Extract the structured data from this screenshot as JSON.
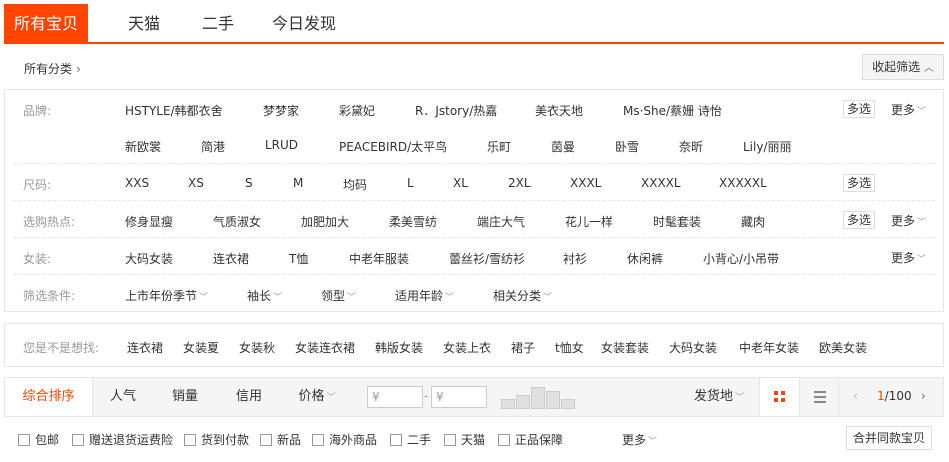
{
  "tabs": [
    "所有宝贝",
    "天猫",
    "二手",
    "今日发现"
  ],
  "breadcrumb": "所有分类",
  "collapse_label": "收起筛选",
  "filters": {
    "brand": {
      "label": "品牌:",
      "row1": [
        "HSTYLE/韩都衣舍",
        "梦梦家",
        "彩黛妃",
        "R．Jstory/热嘉",
        "美衣天地",
        "Ms·She/蔡姗 诗怡"
      ],
      "row2": [
        "新欧裳",
        "简港",
        "LRUD",
        "PEACEBIRD/太平鸟",
        "乐町",
        "茵曼",
        "卧雪",
        "奈昕",
        "Lily/丽丽"
      ]
    },
    "size": {
      "label": "尺码:",
      "items": [
        "XXS",
        "XS",
        "S",
        "M",
        "均码",
        "L",
        "XL",
        "2XL",
        "XXXL",
        "XXXXL",
        "XXXXXL"
      ]
    },
    "hot": {
      "label": "选购热点:",
      "items": [
        "修身显瘦",
        "气质淑女",
        "加肥加大",
        "柔美雪纺",
        "端庄大气",
        "花儿一样",
        "时髦套装",
        "藏肉"
      ]
    },
    "women": {
      "label": "女装:",
      "items": [
        "大码女装",
        "连衣裙",
        "T恤",
        "中老年服装",
        "蕾丝衫/雪纺衫",
        "衬衫",
        "休闲裤",
        "小背心/小吊带"
      ]
    },
    "cond": {
      "label": "筛选条件:",
      "items": [
        "上市年份季节",
        "袖长",
        "领型",
        "适用年龄",
        "相关分类"
      ]
    },
    "multi_label": "多选",
    "more_label": "更多"
  },
  "suggest": {
    "label": "您是不是想找:",
    "items": [
      "连衣裙",
      "女装夏",
      "女装秋",
      "女装连衣裙",
      "韩版女装",
      "女装上衣",
      "裙子",
      "t恤女",
      "女装套装",
      "大码女装",
      "中老年女装",
      "欧美女装"
    ]
  },
  "sortbar": {
    "sorts": [
      "综合排序",
      "人气",
      "销量",
      "信用",
      "价格"
    ],
    "price_placeholder": "¥",
    "dash": "-",
    "ship_from": "发货地",
    "page": "1/100",
    "page_cur": "1",
    "page_total": "/100"
  },
  "options": [
    "包邮",
    "赠送退货运费险",
    "货到付款",
    "新品",
    "海外商品",
    "二手",
    "天猫",
    "正品保障"
  ],
  "options_more": "更多",
  "merge_label": "合并同款宝贝",
  "colors": {
    "accent": "#ff4400"
  }
}
